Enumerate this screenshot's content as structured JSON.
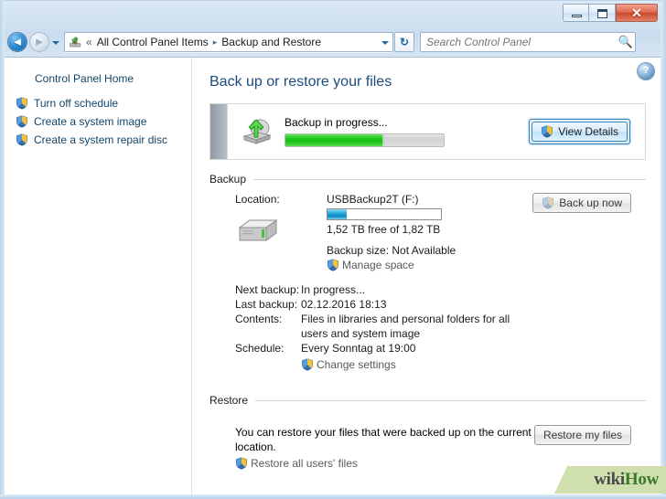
{
  "window": {
    "caption_buttons": {
      "minimize": "minimize-button",
      "maximize": "maximize-button",
      "close_glyph": "✕"
    }
  },
  "navbar": {
    "back_glyph": "◄",
    "forward_glyph": "►",
    "breadcrumb": {
      "overflow": "«",
      "items": [
        "All Control Panel Items",
        "Backup and Restore"
      ],
      "separator": "▸"
    },
    "refresh_glyph": "↻",
    "search": {
      "placeholder": "Search Control Panel",
      "value": "",
      "icon": "search-icon"
    }
  },
  "sidebar": {
    "home_label": "Control Panel Home",
    "items": [
      {
        "label": "Turn off schedule",
        "icon": "shield-icon"
      },
      {
        "label": "Create a system image",
        "icon": "shield-icon"
      },
      {
        "label": "Create a system repair disc",
        "icon": "shield-icon"
      }
    ]
  },
  "main": {
    "page_title": "Back up or restore your files",
    "help_glyph": "?",
    "status": {
      "icon": "backup-drive-icon",
      "text": "Backup in progress...",
      "progress_percent": 61,
      "button_label": "View Details",
      "button_icon": "shield-icon"
    },
    "backup_section": {
      "heading": "Backup",
      "location_label": "Location:",
      "location_value": "USBBackup2T (F:)",
      "disk_used_percent": 17,
      "disk_free_text": "1,52 TB free of 1,82 TB",
      "backup_size_text": "Backup size: Not Available",
      "manage_space_link": "Manage space",
      "drive_icon": "hard-disk-icon",
      "backup_now_button": "Back up now",
      "details": [
        {
          "label": "Next backup:",
          "value": "In progress..."
        },
        {
          "label": "Last backup:",
          "value": "02.12.2016 18:13"
        },
        {
          "label": "Contents:",
          "value": "Files in libraries and personal folders for all users and system image"
        },
        {
          "label": "Schedule:",
          "value": "Every Sonntag at 19:00"
        }
      ],
      "change_settings_link": "Change settings"
    },
    "restore_section": {
      "heading": "Restore",
      "description": "You can restore your files that were backed up on the current location.",
      "restore_all_link": "Restore all users' files",
      "restore_button": "Restore my files"
    }
  },
  "watermark": {
    "part1": "wiki",
    "part2": "How"
  },
  "colors": {
    "title_blue": "#1b4c7d",
    "link_blue": "#12456b",
    "progress_green": "#18bd14",
    "disk_blue": "#0f86c4",
    "watermark_bg": "#cfdfae"
  }
}
